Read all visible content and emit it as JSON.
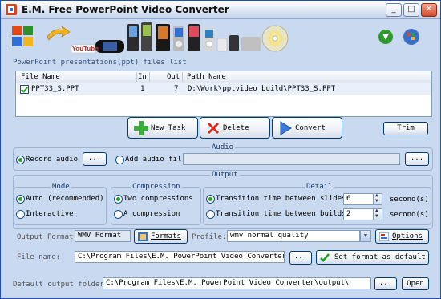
{
  "window": {
    "title": "E.M. Free PowerPoint Video Converter"
  },
  "titlebar_buttons": {
    "minimize": "_",
    "maximize": "□",
    "close": "✕"
  },
  "banner": {
    "youtube": "YouTube"
  },
  "files": {
    "list_label": "PowerPoint presentations(ppt) files list",
    "columns": [
      "File Name",
      "In",
      "Out",
      "Path Name"
    ],
    "rows": [
      {
        "name": "PPT33_S.PPT",
        "in": "1",
        "out": "7",
        "path": "D:\\Work\\pptvideo build\\PPT33_S.PPT"
      }
    ]
  },
  "actions": {
    "new_task": "New Task",
    "delete": "Delete",
    "convert": "Convert",
    "trim": "Trim"
  },
  "audio": {
    "title": "Audio",
    "record_label": "Record audio",
    "add_label": "Add audio fil",
    "browse1": "...",
    "browse2": "...",
    "add_value": ""
  },
  "output": {
    "title": "Output",
    "mode": {
      "title": "Mode",
      "auto": "Auto (recommended)",
      "interactive": "Interactive"
    },
    "compression": {
      "title": "Compression",
      "two": "Two compressions",
      "one": "A compression"
    },
    "detail": {
      "title": "Detail",
      "slides_label": "Transition time between slides",
      "slides_value": "6",
      "builds_label": "Transition time between builds",
      "builds_value": "2",
      "unit": "second(s)"
    },
    "format_label": "Output Format:",
    "format_value": "WMV Format",
    "formats_button": "Formats",
    "profile_label": "Profile:",
    "profile_value": "wmv normal quality",
    "options_button": "Options",
    "file_name_label": "File name:",
    "file_name_value": "C:\\Program Files\\E.M. PowerPoint Video Converter\\ou",
    "file_browse": "...",
    "set_default": "Set format as default",
    "folder_label": "Default output folder:",
    "folder_value": "C:\\Program Files\\E.M. PowerPoint Video Converter\\output\\",
    "folder_browse": "...",
    "open_button": "Open"
  }
}
